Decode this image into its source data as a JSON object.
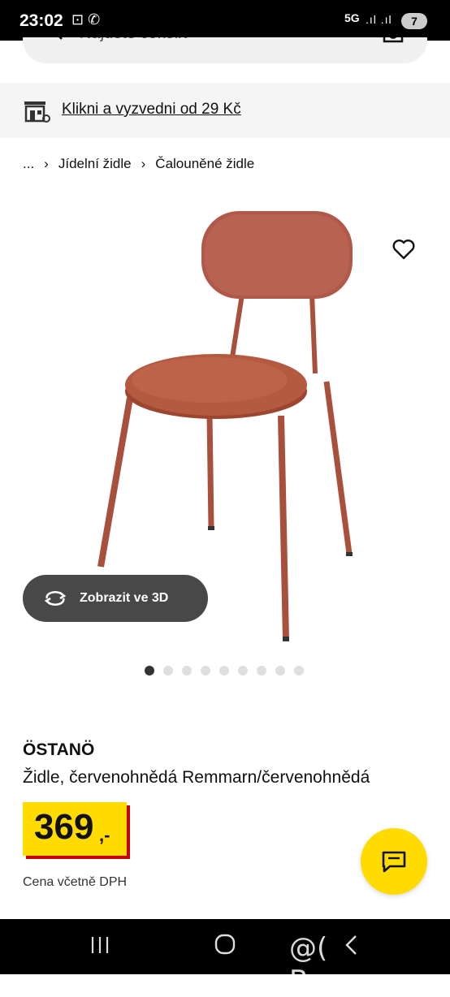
{
  "status_bar": {
    "time": "23:02",
    "network": "5G",
    "battery": "7"
  },
  "search": {
    "placeholder": "Najděte cokoliv"
  },
  "pickup_banner": {
    "label": "Klikni a vyzvedni od 29 Kč"
  },
  "breadcrumb": {
    "ellipsis": "...",
    "items": [
      "Jídelní židle",
      "Čalouněné židle"
    ]
  },
  "gallery": {
    "view_3d_label": "Zobrazit ve 3D",
    "dot_count": 9,
    "active_dot": 0
  },
  "product": {
    "name": "ÖSTANÖ",
    "description": "Židle, červenohnědá Remmarn/červenohnědá",
    "price": "369",
    "price_suffix": ",-",
    "vat_note": "Cena včetně DPH"
  },
  "watermark": "@( Bazos.cz",
  "colors": {
    "accent_yellow": "#ffdb00",
    "price_shadow": "#c80000",
    "chair": "#b3553f"
  },
  "icons": [
    "search-icon",
    "camera-icon",
    "store-icon",
    "heart-icon",
    "rotate-3d-icon",
    "chat-icon",
    "nav-recent-icon",
    "nav-home-icon",
    "nav-back-icon"
  ]
}
